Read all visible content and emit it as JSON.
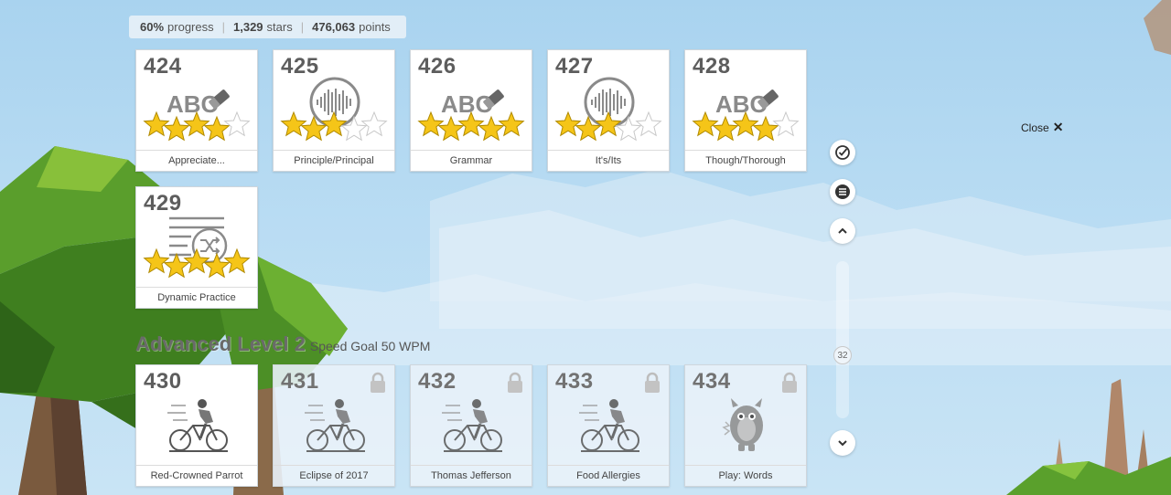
{
  "stats": {
    "progress_value": "60%",
    "progress_label": "progress",
    "stars_value": "1,329",
    "stars_label": "stars",
    "points_value": "476,063",
    "points_label": "points"
  },
  "lessons": [
    {
      "number": "424",
      "title": "Appreciate...",
      "icon": "abc-eraser-icon",
      "stars": 4,
      "max_stars": 5,
      "locked": false
    },
    {
      "number": "425",
      "title": "Principle/Principal",
      "icon": "audio-waveform-icon",
      "stars": 3,
      "max_stars": 5,
      "locked": false
    },
    {
      "number": "426",
      "title": "Grammar",
      "icon": "abc-eraser-icon",
      "stars": 5,
      "max_stars": 5,
      "locked": false
    },
    {
      "number": "427",
      "title": "It's/Its",
      "icon": "audio-waveform-icon",
      "stars": 3,
      "max_stars": 5,
      "locked": false
    },
    {
      "number": "428",
      "title": "Though/Thorough",
      "icon": "abc-eraser-icon",
      "stars": 4,
      "max_stars": 5,
      "locked": false
    },
    {
      "number": "429",
      "title": "Dynamic Practice",
      "icon": "shuffle-practice-icon",
      "stars": 5,
      "max_stars": 5,
      "locked": false
    }
  ],
  "level": {
    "title": "Advanced Level 2",
    "goal": "Speed Goal 50 WPM"
  },
  "level_lessons": [
    {
      "number": "430",
      "title": "Red-Crowned Parrot",
      "icon": "cyclist-icon",
      "locked": false
    },
    {
      "number": "431",
      "title": "Eclipse of 2017",
      "icon": "cyclist-icon",
      "locked": true
    },
    {
      "number": "432",
      "title": "Thomas Jefferson",
      "icon": "cyclist-icon",
      "locked": true
    },
    {
      "number": "433",
      "title": "Food Allergies",
      "icon": "cyclist-icon",
      "locked": true
    },
    {
      "number": "434",
      "title": "Play: Words",
      "icon": "monster-game-icon",
      "locked": true
    }
  ],
  "controls": {
    "close_label": "Close",
    "close_glyph": "✕",
    "scroll_position": "32"
  },
  "colors": {
    "star_fill": "#f5c518",
    "star_outline": "#b08a00",
    "text_dark": "#5d5d5d",
    "icon_gray": "#8a8a8a"
  }
}
